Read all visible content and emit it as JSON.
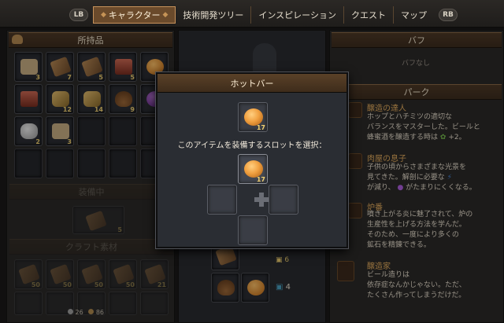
{
  "tabs": {
    "lb": "LB",
    "rb": "RB",
    "items": [
      "キャラクター",
      "技術開発ツリー",
      "インスピレーション",
      "クエスト",
      "マップ"
    ],
    "active_index": 0
  },
  "inventory": {
    "title": "所持品",
    "row1_counts": [
      "3",
      "7",
      "5",
      "5",
      ""
    ],
    "row2_counts": [
      "",
      "12",
      "14",
      "9",
      ""
    ],
    "row3_counts": [
      "2",
      "3",
      "",
      "",
      ""
    ]
  },
  "equip_section": {
    "title": "装備中",
    "count": "5"
  },
  "craft_section": {
    "title": "クラフト素材",
    "row1_counts": [
      "50",
      "50",
      "50",
      "50",
      "21"
    ],
    "row2_counts": [
      "",
      "",
      "",
      "",
      ""
    ]
  },
  "footer": {
    "coin1": "26",
    "coin2": "86"
  },
  "center": {
    "badge_count_1": "6",
    "badge_count_2": "4"
  },
  "buff": {
    "title": "バフ",
    "empty_text": "バフなし"
  },
  "perks": {
    "title": "パーク",
    "list": [
      {
        "name": "醸造の達人",
        "lines": [
          "ホップとハチミツの適切な",
          "バランスをマスターした。ビールと",
          "蜂蜜酒を醸造する時は",
          "+2。"
        ]
      },
      {
        "name": "肉屋の息子",
        "lines": [
          "子供の頃からさまざまな光景を",
          "見てきた。解剖に必要な",
          "が減り、",
          "がたまりにくくなる。"
        ]
      },
      {
        "name": "炉番",
        "lines": [
          "噴き上がる炎に魅了されて、炉の",
          "生産性を上げる方法を学んだ。",
          "そのため、一度により多くの",
          "鉱石を精錬できる。"
        ]
      },
      {
        "name": "醸造家",
        "lines": [
          "ビール造りは",
          "依存症なんかじゃない。ただ、",
          "たくさん作ってしまうだけだ。"
        ]
      }
    ]
  },
  "hotbar": {
    "title": "ホットバー",
    "item_count": "17",
    "prompt": "このアイテムを装備するスロットを選択：",
    "slot_top_count": "17"
  },
  "colors": {
    "accent": "#c7925b",
    "count": "#f0d070",
    "perk_title": "#e8b060"
  }
}
